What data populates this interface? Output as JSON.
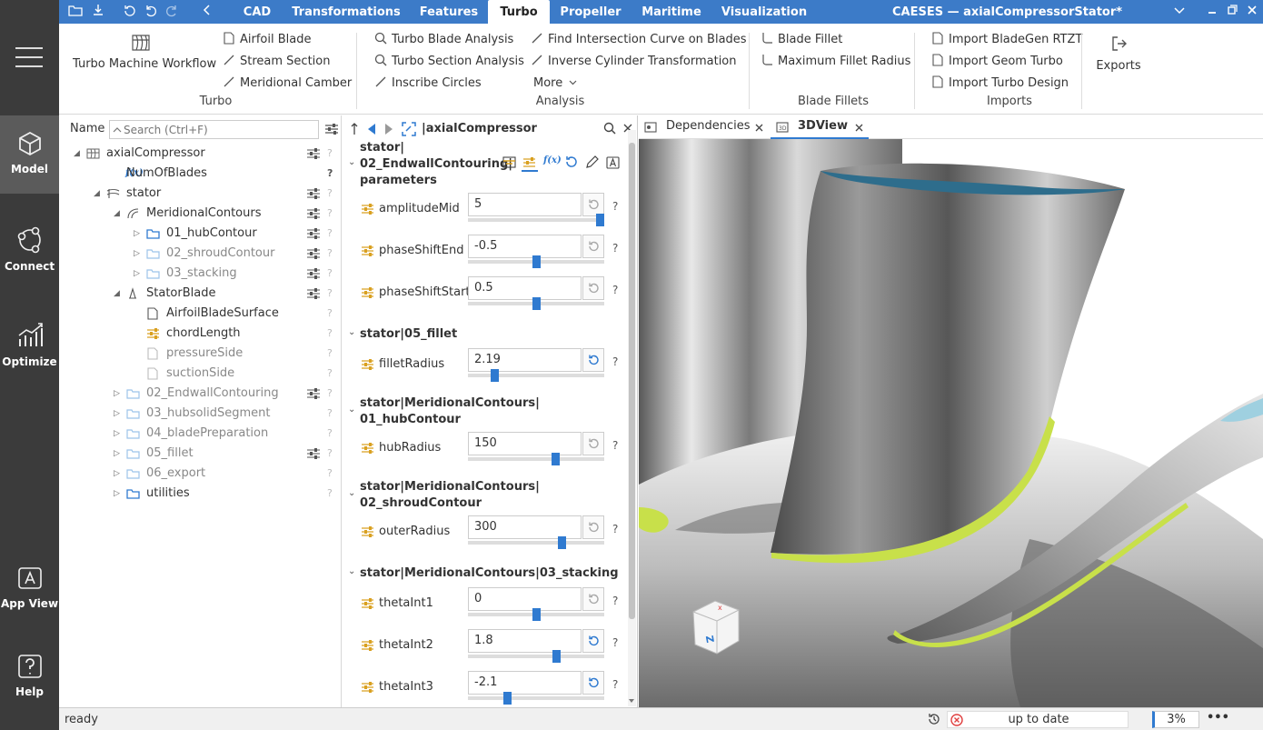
{
  "app": {
    "title": "CAESES — axialCompressorStator*"
  },
  "menu_tabs": [
    {
      "label": "CAD"
    },
    {
      "label": "Transformations"
    },
    {
      "label": "Features"
    },
    {
      "label": "Turbo",
      "active": true
    },
    {
      "label": "Propeller"
    },
    {
      "label": "Maritime"
    },
    {
      "label": "Visualization"
    }
  ],
  "sidebar": {
    "items": [
      {
        "label": "Model",
        "icon": "cube-icon"
      },
      {
        "label": "Connect",
        "icon": "connect-icon"
      },
      {
        "label": "Optimize",
        "icon": "chart-icon"
      },
      {
        "label": "App View",
        "icon": "app-view-icon"
      },
      {
        "label": "Help",
        "icon": "help-icon"
      }
    ]
  },
  "ribbon": {
    "turbo_workflow": "Turbo Machine Workflow",
    "airfoil_blade": "Airfoil Blade",
    "stream_section": "Stream Section",
    "meridional_camber": "Meridional Camber",
    "turbo_group": "Turbo",
    "turbo_blade_analysis": "Turbo Blade Analysis",
    "turbo_section_analysis": "Turbo Section Analysis",
    "inscribe_circles": "Inscribe Circles",
    "find_intersection": "Find Intersection Curve on Blades",
    "inverse_cylinder": "Inverse Cylinder Transformation",
    "more": "More",
    "analysis_group": "Analysis",
    "blade_fillet": "Blade Fillet",
    "max_fillet_radius": "Maximum Fillet Radius",
    "fillets_group": "Blade Fillets",
    "import_bladegen": "Import BladeGen RTZT",
    "import_geom_turbo": "Import Geom Turbo",
    "import_turbo_design": "Import Turbo Design",
    "imports_group": "Imports",
    "exports": "Exports"
  },
  "tree": {
    "name_label": "Name",
    "search_placeholder": "Search (Ctrl+F)",
    "rows": [
      {
        "label": "axialCompressor"
      },
      {
        "label": "NumOfBlades"
      },
      {
        "label": "stator"
      },
      {
        "label": "MeridionalContours"
      },
      {
        "label": "01_hubContour"
      },
      {
        "label": "02_shroudContour"
      },
      {
        "label": "03_stacking"
      },
      {
        "label": "StatorBlade"
      },
      {
        "label": "AirfoilBladeSurface"
      },
      {
        "label": "chordLength"
      },
      {
        "label": "pressureSide"
      },
      {
        "label": "suctionSide"
      },
      {
        "label": "02_EndwallContouring"
      },
      {
        "label": "03_hubsolidSegment"
      },
      {
        "label": "04_bladePreparation"
      },
      {
        "label": "05_fillet"
      },
      {
        "label": "06_export"
      },
      {
        "label": "utilities"
      }
    ],
    "fx": "f(x)",
    "q": "?"
  },
  "params": {
    "crumb": "|axialCompressor",
    "sections": [
      {
        "title": "stator|",
        "title2": "02_EndwallContouring|",
        "title3": "parameters"
      },
      {
        "title": "stator|05_fillet"
      },
      {
        "title": "stator|MeridionalContours|",
        "title2": "01_hubContour"
      },
      {
        "title": "stator|MeridionalContours|",
        "title2": "02_shroudContour"
      },
      {
        "title": "stator|MeridionalContours|03_stacking"
      }
    ],
    "items": [
      {
        "name": "amplitudeMid",
        "value": "5",
        "pos": 1.0
      },
      {
        "name": "phaseShiftEnd",
        "value": "-0.5",
        "pos": 0.5
      },
      {
        "name": "phaseShiftStart",
        "value": "0.5",
        "pos": 0.5
      },
      {
        "name": "filletRadius",
        "value": "2.19",
        "pos": 0.18
      },
      {
        "name": "hubRadius",
        "value": "150",
        "pos": 0.65
      },
      {
        "name": "outerRadius",
        "value": "300",
        "pos": 0.7
      },
      {
        "name": "thetaInt1",
        "value": "0",
        "pos": 0.5
      },
      {
        "name": "thetaInt2",
        "value": "1.8",
        "pos": 0.66
      },
      {
        "name": "thetaInt3",
        "value": "-2.1",
        "pos": 0.28
      }
    ],
    "q": "?"
  },
  "viewport": {
    "tabs": [
      {
        "label": "Dependencies"
      },
      {
        "label": "3DView",
        "active": true
      }
    ]
  },
  "status": {
    "text": "ready",
    "state": "up to date",
    "percent": "3%",
    "more": "•••"
  },
  "colors": {
    "accent": "#3c7bc8",
    "sidebar": "#3b3b3b",
    "fillet": "#c8e04a",
    "blade_inner": "#2e6d8c"
  }
}
